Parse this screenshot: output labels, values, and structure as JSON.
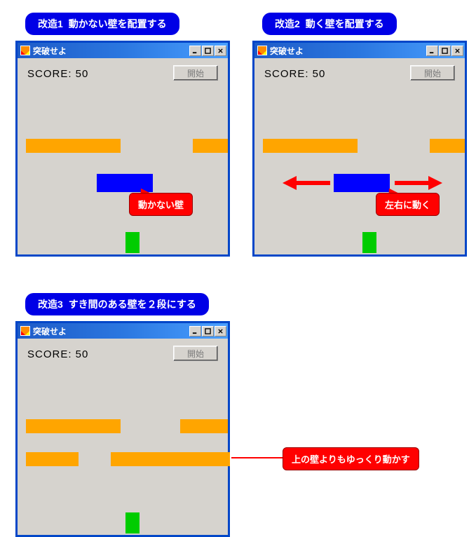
{
  "headings": {
    "h1_num": "改造1",
    "h1_text": "動かない壁を配置する",
    "h2_num": "改造2",
    "h2_text": "動く壁を配置する",
    "h3_num": "改造3",
    "h3_text": "すき間のある壁を２段にする"
  },
  "window": {
    "title": "突破せよ",
    "score_label": "SCORE: 50",
    "start_button": "開始"
  },
  "callouts": {
    "c1": "動かない壁",
    "c2": "左右に動く",
    "c3": "上の壁よりもゆっくり動かす"
  }
}
